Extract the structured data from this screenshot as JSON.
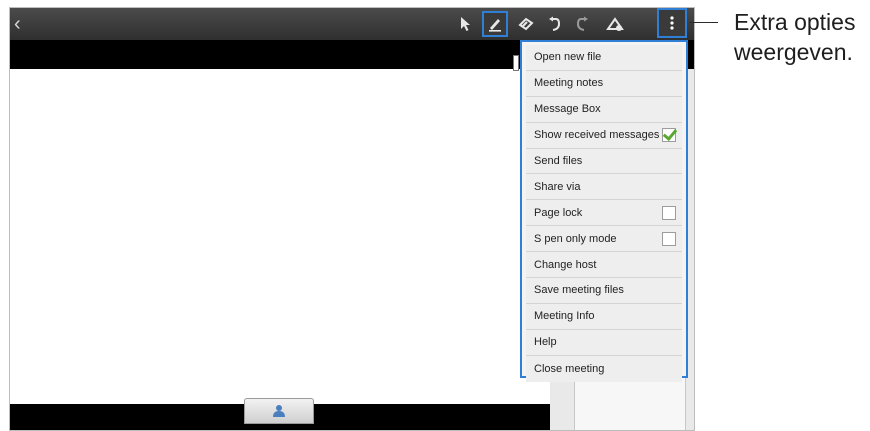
{
  "app": {
    "title": "",
    "back_icon": "chevron-left-icon"
  },
  "toolbar": {
    "tools": [
      {
        "name": "select",
        "icon": "pointer-icon"
      },
      {
        "name": "pen",
        "icon": "pen-icon",
        "active": true
      },
      {
        "name": "eraser",
        "icon": "eraser-icon"
      },
      {
        "name": "undo",
        "icon": "undo-icon"
      },
      {
        "name": "redo",
        "icon": "redo-icon"
      },
      {
        "name": "document",
        "icon": "document-icon"
      }
    ],
    "more_icon": "more-options-icon",
    "accent": "#2f7fd6"
  },
  "menu": {
    "items": [
      {
        "label": "Open new file"
      },
      {
        "label": "Meeting notes"
      },
      {
        "label": "Message Box"
      },
      {
        "label": "Show received messages",
        "checkbox": true,
        "checked": true
      },
      {
        "label": "Send files"
      },
      {
        "label": "Share via"
      },
      {
        "label": "Page lock",
        "checkbox": true,
        "checked": false
      },
      {
        "label": "S pen only mode",
        "checkbox": true,
        "checked": false
      },
      {
        "label": "Change host"
      },
      {
        "label": "Save meeting files"
      },
      {
        "label": "Meeting Info"
      },
      {
        "label": "Help"
      },
      {
        "label": "Close meeting"
      }
    ]
  },
  "callout": {
    "text": "Extra opties\nweergeven."
  },
  "bottom": {
    "tab_icon": "participant-icon"
  }
}
